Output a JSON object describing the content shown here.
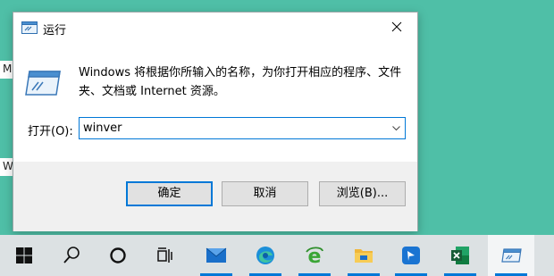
{
  "desktop": {
    "fragments": [
      "M",
      "W"
    ]
  },
  "dialog": {
    "title": "运行",
    "description": "Windows 将根据你所输入的名称，为你打开相应的程序、文件夹、文档或 Internet 资源。",
    "open_label": "打开(O):",
    "open_value": "winver",
    "buttons": {
      "ok": "确定",
      "cancel": "取消",
      "browse": "浏览(B)..."
    }
  },
  "taskbar": {
    "items": [
      {
        "icon": "windows-start-icon"
      },
      {
        "icon": "search-icon"
      },
      {
        "icon": "cortana-icon"
      },
      {
        "icon": "task-view-icon"
      },
      {
        "icon": "mail-icon",
        "running": true
      },
      {
        "icon": "edge-icon",
        "running": true
      },
      {
        "icon": "internet-explorer-icon",
        "running": true
      },
      {
        "icon": "file-explorer-icon",
        "running": true
      },
      {
        "icon": "feedback-icon",
        "running": true
      },
      {
        "icon": "excel-icon",
        "running": true
      },
      {
        "icon": "run-icon",
        "running": true,
        "active": true
      }
    ]
  },
  "colors": {
    "accent": "#0078d7",
    "desktop": "#4fbfa7",
    "taskbar": "#dce1e3"
  }
}
